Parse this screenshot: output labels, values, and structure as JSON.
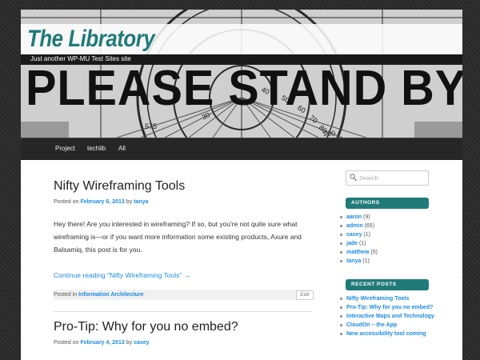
{
  "site": {
    "title": "The Libratory",
    "tagline": "Just another WP-MU Test Sites site",
    "header_image_text": "PLEASE STAND BY",
    "header_dial_numbers": [
      "575",
      "30",
      "20",
      "40",
      "50",
      "60",
      "70",
      "80",
      "900"
    ]
  },
  "nav": {
    "items": [
      {
        "label": "Project"
      },
      {
        "label": "techlib"
      },
      {
        "label": "All"
      }
    ]
  },
  "posts": [
    {
      "title": "Nifty Wireframing Tools",
      "posted_on": "Posted on",
      "date": "February 6, 2013",
      "by": "by",
      "author": "tanya",
      "excerpt": "Hey there! Are you interested in wireframing? If so, but you're not quite sure what wireframing is—or if you want more information some existing products, Axure and Balsamiq, this post is for you.",
      "continue_link": "Continue reading \"Nifty Wireframing Tools\" →",
      "posted_in": "Posted in",
      "category": "Information Architecture",
      "edit_label": "Edit"
    },
    {
      "title": "Pro-Tip: Why for you no embed?",
      "posted_on": "Posted on",
      "date": "February 4, 2013",
      "by": "by",
      "author": "casey"
    }
  ],
  "sidebar": {
    "search_placeholder": "Search",
    "authors_title": "AUTHORS",
    "authors": [
      {
        "name": "aaron",
        "count": "(9)"
      },
      {
        "name": "admin",
        "count": "(65)"
      },
      {
        "name": "casey",
        "count": "(1)"
      },
      {
        "name": "jade",
        "count": "(1)"
      },
      {
        "name": "matthew",
        "count": "(5)"
      },
      {
        "name": "tanya",
        "count": "(1)"
      }
    ],
    "recent_title": "RECENT POSTS",
    "recent_posts": [
      "Nifty Wireframing Tools",
      "Pro-Tip: Why for you no embed?",
      "Interactive Maps and Technology",
      "CloudOn – the App",
      "New accessibility tool coming"
    ]
  },
  "colors": {
    "accent": "#1f7a78",
    "link": "#1b8be0",
    "nav_bg": "#262626"
  }
}
